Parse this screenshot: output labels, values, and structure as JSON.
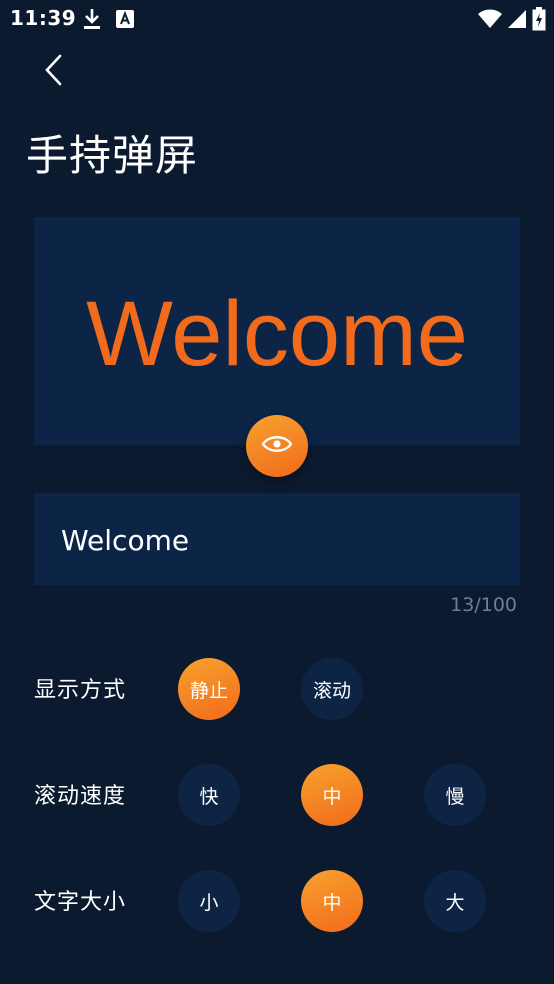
{
  "status_bar": {
    "time": "11:39",
    "left_icons": [
      "download-icon",
      "text-a-icon"
    ],
    "right_icons": [
      "wifi-icon",
      "signal-icon",
      "battery-icon"
    ]
  },
  "nav": {
    "back_icon": "chevron-left-icon"
  },
  "title": "手持弹屏",
  "preview": {
    "text": "Welcome",
    "text_color": "#f26a1b",
    "button_icon": "eye-icon"
  },
  "input": {
    "value": "Welcome",
    "counter": "13/100"
  },
  "settings": {
    "display_mode": {
      "label": "显示方式",
      "options": [
        "静止",
        "滚动"
      ],
      "selected": 0
    },
    "scroll_speed": {
      "label": "滚动速度",
      "options": [
        "快",
        "中",
        "慢"
      ],
      "selected": 1
    },
    "text_size": {
      "label": "文字大小",
      "options": [
        "小",
        "中",
        "大"
      ],
      "selected": 1
    }
  },
  "colors": {
    "background": "#0c1a30",
    "panel": "#0c2546",
    "accent": "#f7931e"
  }
}
